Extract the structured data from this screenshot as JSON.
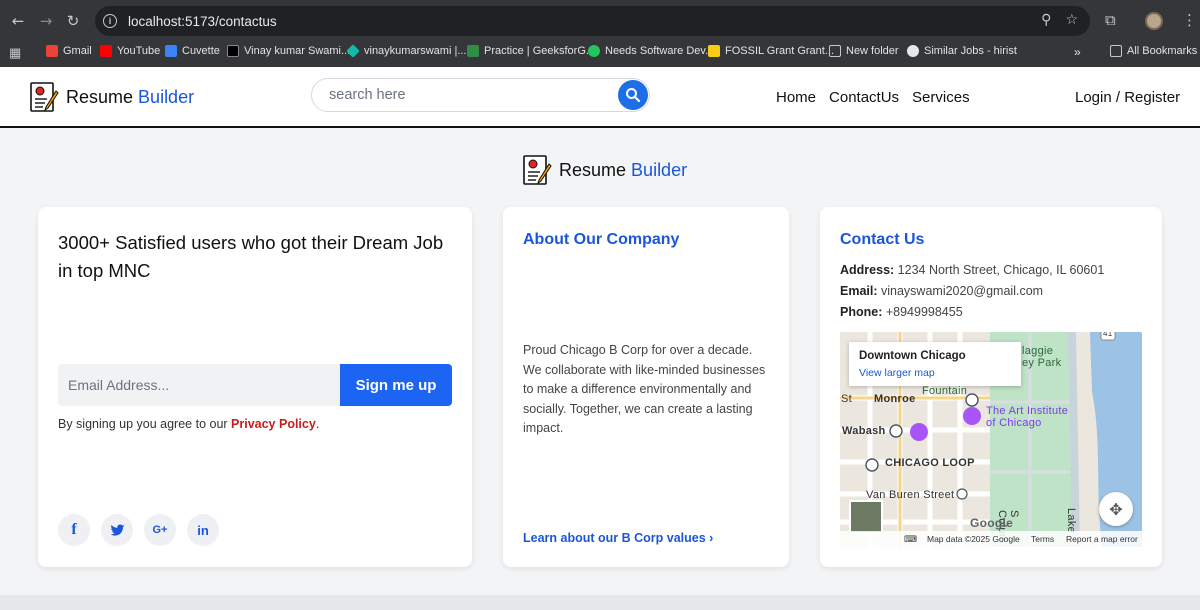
{
  "browser": {
    "url": "localhost:5173/contactus",
    "bookmarks": [
      {
        "label": "Gmail",
        "color": "#ea4335"
      },
      {
        "label": "YouTube",
        "color": "#ff0000"
      },
      {
        "label": "Cuvette",
        "color": "#3b82f6"
      },
      {
        "label": "Vinay kumar Swami...",
        "color": "#000000"
      },
      {
        "label": "vinaykumarswami |...",
        "color": "#14b8a6"
      },
      {
        "label": "Practice | GeeksforG...",
        "color": "#2f8d46"
      },
      {
        "label": "Needs Software Dev...",
        "color": "#22c55e"
      },
      {
        "label": "FOSSIL Grant Grant...",
        "color": "#facc15"
      },
      {
        "label": "New folder",
        "color": "#9ca3af"
      },
      {
        "label": "Similar Jobs - hirist",
        "color": "#e5e7eb"
      }
    ],
    "all_bookmarks": "All Bookmarks"
  },
  "header": {
    "brand_main": "Resume",
    "brand_accent": "Builder",
    "search_placeholder": "search here",
    "nav": [
      "Home",
      "ContactUs",
      "Services"
    ],
    "login": "Login / Register"
  },
  "signup_card": {
    "headline": "3000+ Satisfied users who got their Dream Job in top MNC",
    "email_placeholder": "Email Address...",
    "button": "Sign me up",
    "agree_prefix": "By signing up you agree to our ",
    "policy_link": "Privacy Policy",
    "agree_suffix": ".",
    "socials": [
      "f",
      "t",
      "G+",
      "in"
    ]
  },
  "about_card": {
    "title": "About Our Company",
    "text": "Proud Chicago B Corp for over a decade. We collaborate with like-minded businesses to make a difference environmentally and socially. Together, we can create a lasting impact.",
    "link": "Learn about our B Corp values ›"
  },
  "contact_card": {
    "title": "Contact Us",
    "address_label": "Address:",
    "address": "1234 North Street, Chicago, IL 60601",
    "email_label": "Email:",
    "email": "vinayswami2020@gmail.com",
    "phone_label": "Phone:",
    "phone": "+8949998455",
    "map": {
      "place": "Downtown Chicago",
      "larger_map": "View larger map",
      "labels": {
        "monroe": "Monroe",
        "wabash": "Wabash",
        "loop": "CHICAGO LOOP",
        "vanburen": "Van Buren Street",
        "fountain": "Fountain",
        "art1": "The Art Institute",
        "art2": "of Chicago",
        "maggie": "laggie",
        "park": "ey Park",
        "colum": "S Colum",
        "lake": "Lake",
        "route": "41",
        "st": "St",
        "google": "Google"
      },
      "footer_data": "Map data ©2025 Google",
      "footer_terms": "Terms",
      "footer_report": "Report a map error"
    }
  }
}
